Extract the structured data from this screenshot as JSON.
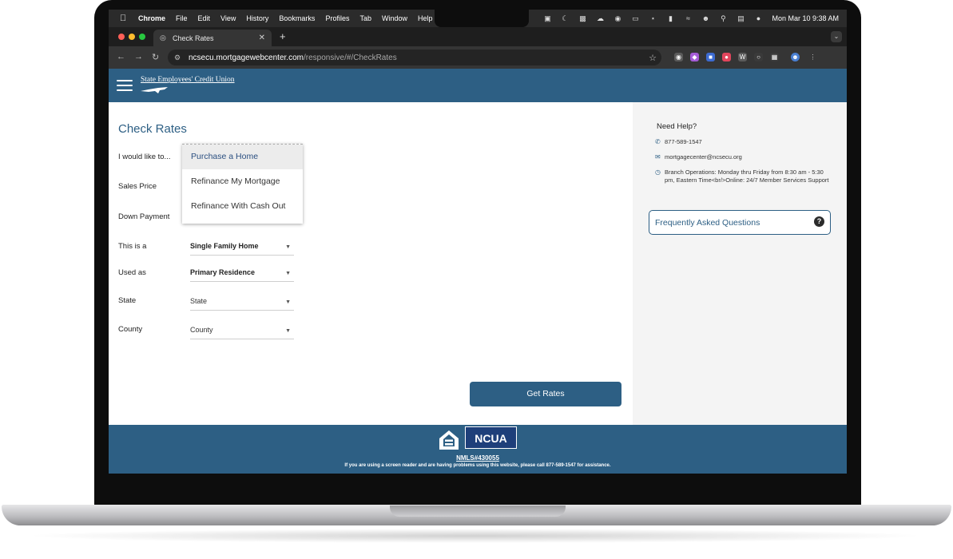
{
  "menubar": {
    "app": "Chrome",
    "items": [
      "File",
      "Edit",
      "View",
      "History",
      "Bookmarks",
      "Profiles",
      "Tab",
      "Window",
      "Help"
    ],
    "clock": "Mon Mar 10  9:38 AM"
  },
  "browser": {
    "tab_title": "Check Rates",
    "url_host": "ncsecu.mortgagewebcenter.com",
    "url_path": "/responsive/#/CheckRates"
  },
  "site": {
    "brand": "State Employees' Credit Union",
    "colors": {
      "primary": "#2d5f84",
      "link": "#2b4f80"
    }
  },
  "form": {
    "title": "Check Rates",
    "labels": {
      "purpose": "I would like to...",
      "sales_price": "Sales Price",
      "down_payment": "Down Payment",
      "property_type": "This is a",
      "occupancy": "Used as",
      "state": "State",
      "county": "County"
    },
    "purpose_options": [
      "Purchase a Home",
      "Refinance My Mortgage",
      "Refinance With Cash Out"
    ],
    "property_type_value": "Single Family Home",
    "occupancy_value": "Primary Residence",
    "state_value": "State",
    "county_value": "County",
    "submit": "Get Rates"
  },
  "help": {
    "title": "Need Help?",
    "phone": "877-589-1547",
    "email": "mortgagecenter@ncsecu.org",
    "hours": "Branch Operations: Monday thru Friday from 8:30 am - 5:30 pm, Eastern Time<br/>Online: 24/7 Member Services Support",
    "faq": "Frequently Asked Questions"
  },
  "footer": {
    "ncua": "NCUA",
    "nmls": "NMLS#430055",
    "screen_reader_note": "If you are using a screen reader and are having problems using this website, please call 877-589-1547 for assistance."
  }
}
